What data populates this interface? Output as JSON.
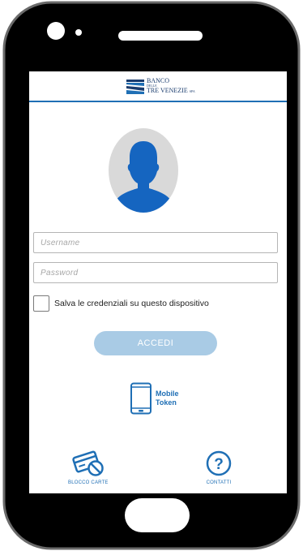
{
  "header": {
    "logo": {
      "line1": "BANCO",
      "line2": "DELLE",
      "line3": "TRE VENEZIE",
      "suffix": "SPA"
    }
  },
  "login": {
    "username_placeholder": "Username",
    "password_placeholder": "Password",
    "remember_label": "Salva le credenziali su questo dispositivo",
    "remember_checked": false,
    "submit_label": "ACCEDI"
  },
  "mobile_token": {
    "line1": "Mobile",
    "line2": "Token",
    "icon": "smartphone-icon"
  },
  "footer": {
    "items": [
      {
        "label": "BLOCCO CARTE",
        "icon": "block-card-icon"
      },
      {
        "label": "CONTATTI",
        "icon": "question-circle-icon"
      }
    ]
  },
  "colors": {
    "brand_blue": "#1f6fb5",
    "logo_navy": "#1a3c6e",
    "button_disabled": "#a9cbe5",
    "phone_body": "#000000",
    "avatar_bg": "#d9d9d9",
    "avatar_figure": "#1565c0"
  }
}
